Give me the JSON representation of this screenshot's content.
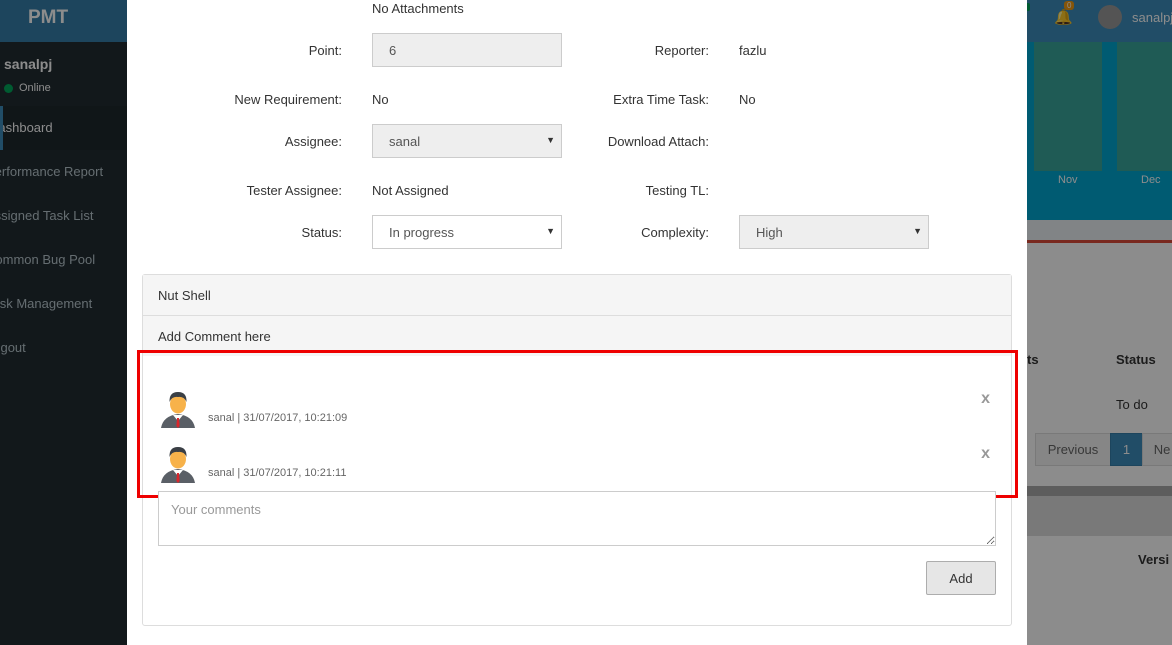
{
  "app": {
    "logo": "PMT",
    "user_name": "sanalpj",
    "status": "Online",
    "menu": [
      {
        "label": "Dashboard",
        "active": true
      },
      {
        "label": "Performance Report",
        "active": false
      },
      {
        "label": "Assigned Task List",
        "active": false
      },
      {
        "label": "Common Bug Pool",
        "active": false
      },
      {
        "label": "Task Management",
        "active": false
      },
      {
        "label": "Logout",
        "active": false
      }
    ],
    "header_user": "sanalpj",
    "notification_count": "0",
    "chart_months": [
      "Nov",
      "Dec"
    ],
    "table_header_partial": "ts",
    "table_status_header": "Status",
    "table_status_value": "To do",
    "pager": {
      "previous": "Previous",
      "current": "1",
      "next": "Ne"
    },
    "versi": "Versi"
  },
  "task": {
    "attachments": "No Attachments",
    "point_label": "Point:",
    "point_value": "6",
    "reporter_label": "Reporter:",
    "reporter_value": "fazlu",
    "new_req_label": "New Requirement:",
    "new_req_value": "No",
    "extra_time_label": "Extra Time Task:",
    "extra_time_value": "No",
    "assignee_label": "Assignee:",
    "assignee_value": "sanal",
    "download_label": "Download Attach:",
    "tester_label": "Tester Assignee:",
    "tester_value": "Not Assigned",
    "testing_tl_label": "Testing TL:",
    "status_label": "Status:",
    "status_value": "In progress",
    "complexity_label": "Complexity:",
    "complexity_value": "High"
  },
  "comments_panel": {
    "title": "Nut Shell",
    "subtitle": "Add Comment here",
    "comments": [
      {
        "meta": "sanal | 31/07/2017, 10:21:09",
        "delete": "x"
      },
      {
        "meta": "sanal | 31/07/2017, 10:21:11",
        "delete": "x"
      }
    ],
    "textarea_placeholder": "Your comments",
    "add_button": "Add"
  }
}
